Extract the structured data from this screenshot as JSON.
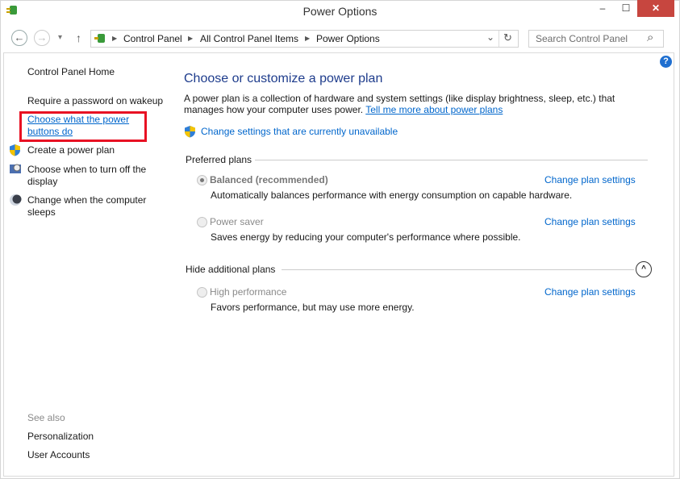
{
  "window": {
    "title": "Power Options",
    "minimize": "‒",
    "maximize": "☐",
    "close": "✕"
  },
  "nav": {
    "back": "←",
    "forward": "→",
    "recent": "▾",
    "up": "↑",
    "breadcrumb": [
      "Control Panel",
      "All Control Panel Items",
      "Power Options"
    ],
    "address_dropdown": "⌄",
    "refresh": "↻",
    "search_placeholder": "Search Control Panel",
    "search_icon": "⌕"
  },
  "sidebar": {
    "home": "Control Panel Home",
    "items": [
      {
        "label": "Require a password on wakeup",
        "icon": ""
      },
      {
        "label": "Choose what the power buttons do",
        "icon": "",
        "highlighted": true
      },
      {
        "label": "Create a power plan",
        "icon": "shield-icon"
      },
      {
        "label": "Choose when to turn off the display",
        "icon": "monitor-clock-icon"
      },
      {
        "label": "Change when the computer sleeps",
        "icon": "moon-icon"
      }
    ],
    "see_also": "See also",
    "see_also_links": [
      "Personalization",
      "User Accounts"
    ]
  },
  "main": {
    "title": "Choose or customize a power plan",
    "description": "A power plan is a collection of hardware and system settings (like display brightness, sleep, etc.) that manages how your computer uses power.",
    "tell_more": "Tell me more about power plans",
    "change_unavailable": "Change settings that are currently unavailable",
    "preferred_header": "Preferred plans",
    "hide_header": "Hide additional plans",
    "plans": [
      {
        "name": "Balanced (recommended)",
        "selected": true,
        "description": "Automatically balances performance with energy consumption on capable hardware.",
        "link": "Change plan settings"
      },
      {
        "name": "Power saver",
        "selected": false,
        "description": "Saves energy by reducing your computer's performance where possible.",
        "link": "Change plan settings"
      },
      {
        "name": "High performance",
        "selected": false,
        "description": "Favors performance, but may use more energy.",
        "link": "Change plan settings"
      }
    ],
    "help": "?"
  },
  "colors": {
    "link": "#0066cc",
    "heading": "#1e3c8c",
    "close": "#c7463f",
    "highlight": "#e81123"
  }
}
